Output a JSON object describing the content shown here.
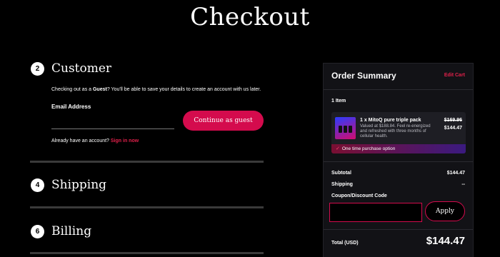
{
  "page": {
    "title": "Checkout"
  },
  "steps": {
    "customer": {
      "number": "2",
      "title": "Customer"
    },
    "shipping": {
      "number": "4",
      "title": "Shipping"
    },
    "billing": {
      "number": "6",
      "title": "Billing"
    }
  },
  "customer": {
    "guest_prefix": "Checking out as a ",
    "guest_bold": "Guest",
    "guest_suffix": "? You'll be able to save your details to create an account with us later.",
    "email_label": "Email Address",
    "email_value": "",
    "continue_label": "Continue as guest",
    "account_prefix": "Already have an account? ",
    "signin_label": "Sign in now"
  },
  "summary": {
    "title": "Order Summary",
    "edit_cart": "Edit Cart",
    "item_count": "1 Item",
    "item": {
      "name": "1 x MitoQ pure triple pack",
      "description": "Valued at $188.84. Feel re-energized and refreshed with three months of cellular health.",
      "original_price": "$169.96",
      "price": "$144.47",
      "purchase_option": "One time purchase option",
      "purchase_icon": "check-icon"
    },
    "subtotal_label": "Subtotal",
    "subtotal_value": "$144.47",
    "shipping_label": "Shipping",
    "shipping_value": "--",
    "coupon_label": "Coupon/Discount Code",
    "coupon_value": "",
    "apply_label": "Apply",
    "total_label": "Total (USD)",
    "total_value": "$144.47"
  },
  "colors": {
    "accent": "#d40b4d",
    "background": "#000000",
    "panel": "#121216"
  }
}
